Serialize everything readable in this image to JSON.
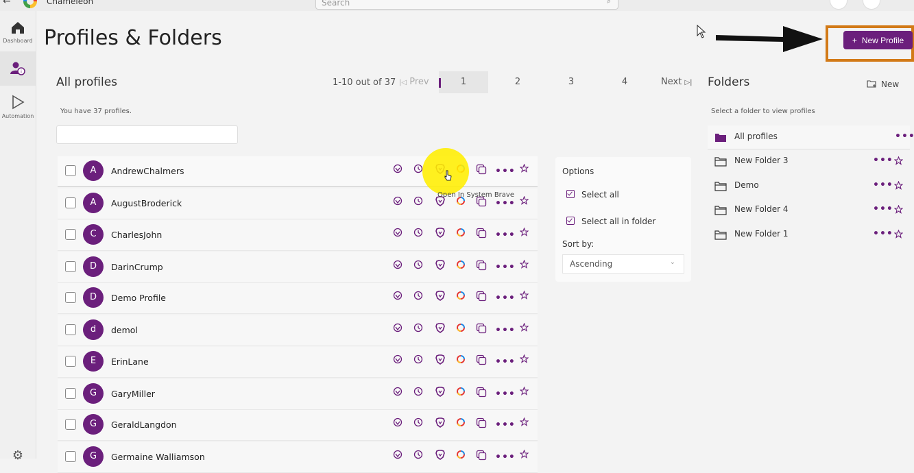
{
  "app": {
    "name": "Chameleon",
    "search_placeholder": "Search"
  },
  "sidebar": {
    "items": [
      {
        "label": "Dashboard",
        "icon": "home-icon"
      },
      {
        "label": "",
        "icon": "profiles-icon"
      },
      {
        "label": "Automation",
        "icon": "play-icon"
      }
    ]
  },
  "page": {
    "title": "Profiles & Folders"
  },
  "profiles": {
    "title": "All profiles",
    "range_text": "1-10 out of 37",
    "prev_label": "Prev",
    "next_label": "Next",
    "pages": [
      "1",
      "2",
      "3",
      "4"
    ],
    "current_page": "1",
    "count_text": "You have 37 profiles.",
    "rows": [
      {
        "initial": "A",
        "name": "AndrewChalmers"
      },
      {
        "initial": "A",
        "name": "AugustBroderick"
      },
      {
        "initial": "C",
        "name": "CharlesJohn"
      },
      {
        "initial": "D",
        "name": "DarinCrump"
      },
      {
        "initial": "D",
        "name": "Demo Profile"
      },
      {
        "initial": "d",
        "name": "demol"
      },
      {
        "initial": "E",
        "name": "ErinLane"
      },
      {
        "initial": "G",
        "name": "GaryMiller"
      },
      {
        "initial": "G",
        "name": "GeraldLangdon"
      },
      {
        "initial": "G",
        "name": "Germaine Walliamson"
      }
    ],
    "tooltip": "Open In System Brave"
  },
  "options": {
    "title": "Options",
    "select_all": "Select all",
    "select_all_in_folder": "Select all in folder",
    "sort_label": "Sort by:",
    "sort_value": "Ascending"
  },
  "folders": {
    "title": "Folders",
    "new_label": "New",
    "hint": "Select a folder to view profiles",
    "items": [
      {
        "name": "All profiles"
      },
      {
        "name": "New Folder 3"
      },
      {
        "name": "Demo"
      },
      {
        "name": "New Folder 4"
      },
      {
        "name": "New Folder 1"
      }
    ]
  },
  "header": {
    "new_profile_label": "New Profile"
  },
  "colors": {
    "accent": "#6b1f7c",
    "highlight": "#d27a17",
    "spotlight": "#ffee00"
  }
}
